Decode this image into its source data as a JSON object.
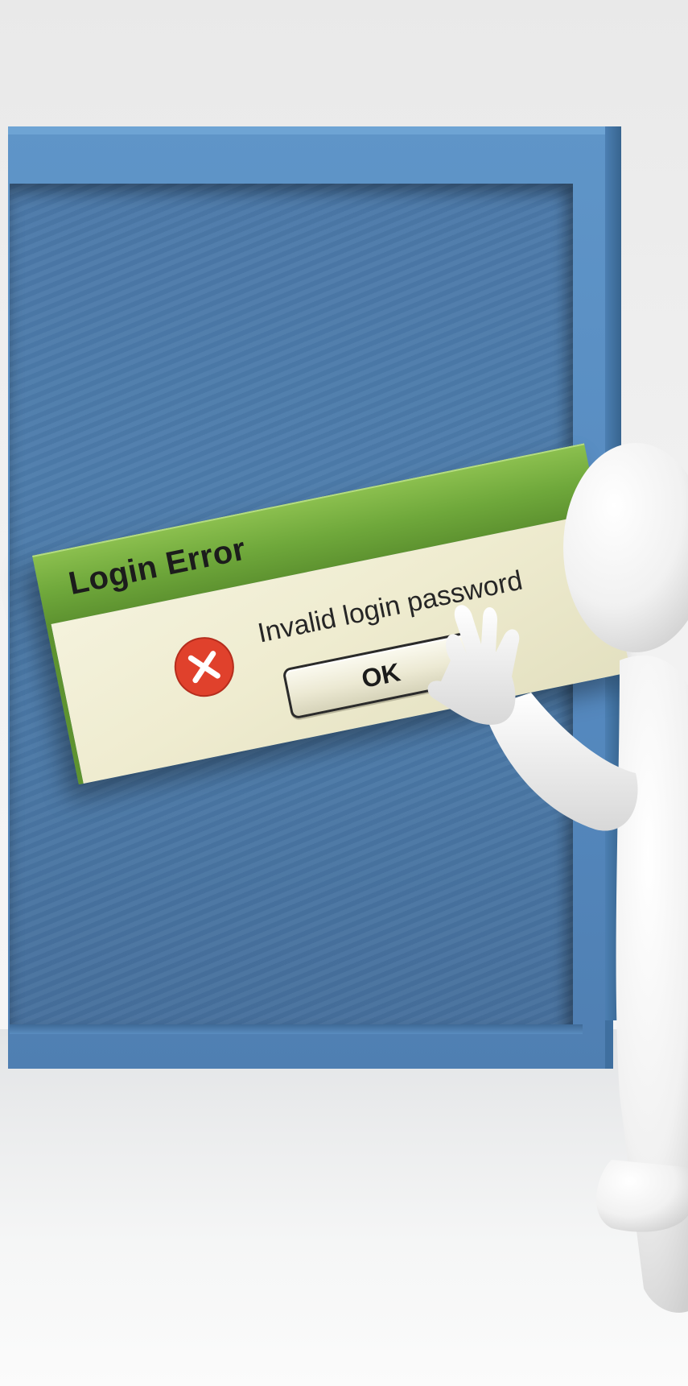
{
  "dialog": {
    "title": "Login Error",
    "message": "Invalid login password",
    "ok_label": "OK",
    "icon": "error-x-icon"
  },
  "colors": {
    "titlebar": "#6fa83b",
    "body": "#efecd0",
    "frame": "#5589bf",
    "screen": "#4b78a8",
    "error_icon": "#e0412c"
  }
}
